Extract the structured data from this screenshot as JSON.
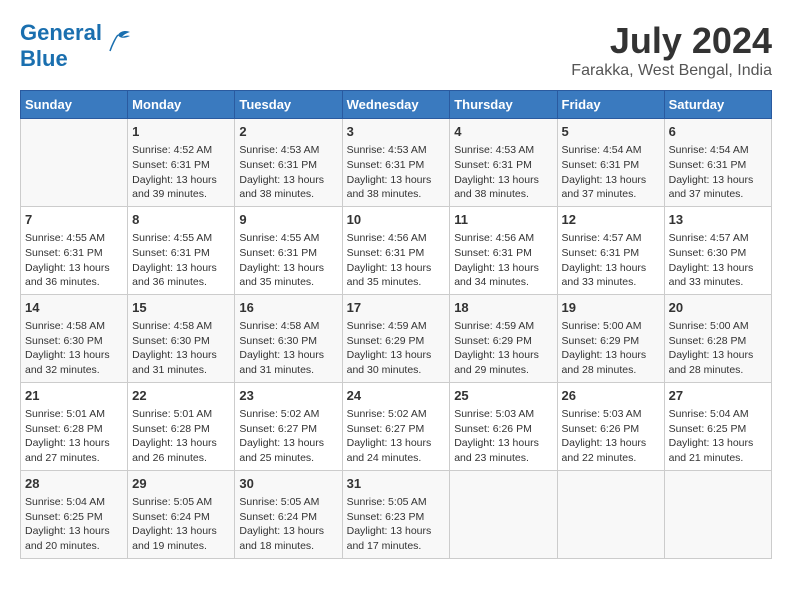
{
  "header": {
    "logo_line1": "General",
    "logo_line2": "Blue",
    "title": "July 2024",
    "subtitle": "Farakka, West Bengal, India"
  },
  "weekdays": [
    "Sunday",
    "Monday",
    "Tuesday",
    "Wednesday",
    "Thursday",
    "Friday",
    "Saturday"
  ],
  "weeks": [
    [
      {
        "day": "",
        "info": ""
      },
      {
        "day": "1",
        "info": "Sunrise: 4:52 AM\nSunset: 6:31 PM\nDaylight: 13 hours\nand 39 minutes."
      },
      {
        "day": "2",
        "info": "Sunrise: 4:53 AM\nSunset: 6:31 PM\nDaylight: 13 hours\nand 38 minutes."
      },
      {
        "day": "3",
        "info": "Sunrise: 4:53 AM\nSunset: 6:31 PM\nDaylight: 13 hours\nand 38 minutes."
      },
      {
        "day": "4",
        "info": "Sunrise: 4:53 AM\nSunset: 6:31 PM\nDaylight: 13 hours\nand 38 minutes."
      },
      {
        "day": "5",
        "info": "Sunrise: 4:54 AM\nSunset: 6:31 PM\nDaylight: 13 hours\nand 37 minutes."
      },
      {
        "day": "6",
        "info": "Sunrise: 4:54 AM\nSunset: 6:31 PM\nDaylight: 13 hours\nand 37 minutes."
      }
    ],
    [
      {
        "day": "7",
        "info": "Sunrise: 4:55 AM\nSunset: 6:31 PM\nDaylight: 13 hours\nand 36 minutes."
      },
      {
        "day": "8",
        "info": "Sunrise: 4:55 AM\nSunset: 6:31 PM\nDaylight: 13 hours\nand 36 minutes."
      },
      {
        "day": "9",
        "info": "Sunrise: 4:55 AM\nSunset: 6:31 PM\nDaylight: 13 hours\nand 35 minutes."
      },
      {
        "day": "10",
        "info": "Sunrise: 4:56 AM\nSunset: 6:31 PM\nDaylight: 13 hours\nand 35 minutes."
      },
      {
        "day": "11",
        "info": "Sunrise: 4:56 AM\nSunset: 6:31 PM\nDaylight: 13 hours\nand 34 minutes."
      },
      {
        "day": "12",
        "info": "Sunrise: 4:57 AM\nSunset: 6:31 PM\nDaylight: 13 hours\nand 33 minutes."
      },
      {
        "day": "13",
        "info": "Sunrise: 4:57 AM\nSunset: 6:30 PM\nDaylight: 13 hours\nand 33 minutes."
      }
    ],
    [
      {
        "day": "14",
        "info": "Sunrise: 4:58 AM\nSunset: 6:30 PM\nDaylight: 13 hours\nand 32 minutes."
      },
      {
        "day": "15",
        "info": "Sunrise: 4:58 AM\nSunset: 6:30 PM\nDaylight: 13 hours\nand 31 minutes."
      },
      {
        "day": "16",
        "info": "Sunrise: 4:58 AM\nSunset: 6:30 PM\nDaylight: 13 hours\nand 31 minutes."
      },
      {
        "day": "17",
        "info": "Sunrise: 4:59 AM\nSunset: 6:29 PM\nDaylight: 13 hours\nand 30 minutes."
      },
      {
        "day": "18",
        "info": "Sunrise: 4:59 AM\nSunset: 6:29 PM\nDaylight: 13 hours\nand 29 minutes."
      },
      {
        "day": "19",
        "info": "Sunrise: 5:00 AM\nSunset: 6:29 PM\nDaylight: 13 hours\nand 28 minutes."
      },
      {
        "day": "20",
        "info": "Sunrise: 5:00 AM\nSunset: 6:28 PM\nDaylight: 13 hours\nand 28 minutes."
      }
    ],
    [
      {
        "day": "21",
        "info": "Sunrise: 5:01 AM\nSunset: 6:28 PM\nDaylight: 13 hours\nand 27 minutes."
      },
      {
        "day": "22",
        "info": "Sunrise: 5:01 AM\nSunset: 6:28 PM\nDaylight: 13 hours\nand 26 minutes."
      },
      {
        "day": "23",
        "info": "Sunrise: 5:02 AM\nSunset: 6:27 PM\nDaylight: 13 hours\nand 25 minutes."
      },
      {
        "day": "24",
        "info": "Sunrise: 5:02 AM\nSunset: 6:27 PM\nDaylight: 13 hours\nand 24 minutes."
      },
      {
        "day": "25",
        "info": "Sunrise: 5:03 AM\nSunset: 6:26 PM\nDaylight: 13 hours\nand 23 minutes."
      },
      {
        "day": "26",
        "info": "Sunrise: 5:03 AM\nSunset: 6:26 PM\nDaylight: 13 hours\nand 22 minutes."
      },
      {
        "day": "27",
        "info": "Sunrise: 5:04 AM\nSunset: 6:25 PM\nDaylight: 13 hours\nand 21 minutes."
      }
    ],
    [
      {
        "day": "28",
        "info": "Sunrise: 5:04 AM\nSunset: 6:25 PM\nDaylight: 13 hours\nand 20 minutes."
      },
      {
        "day": "29",
        "info": "Sunrise: 5:05 AM\nSunset: 6:24 PM\nDaylight: 13 hours\nand 19 minutes."
      },
      {
        "day": "30",
        "info": "Sunrise: 5:05 AM\nSunset: 6:24 PM\nDaylight: 13 hours\nand 18 minutes."
      },
      {
        "day": "31",
        "info": "Sunrise: 5:05 AM\nSunset: 6:23 PM\nDaylight: 13 hours\nand 17 minutes."
      },
      {
        "day": "",
        "info": ""
      },
      {
        "day": "",
        "info": ""
      },
      {
        "day": "",
        "info": ""
      }
    ]
  ]
}
